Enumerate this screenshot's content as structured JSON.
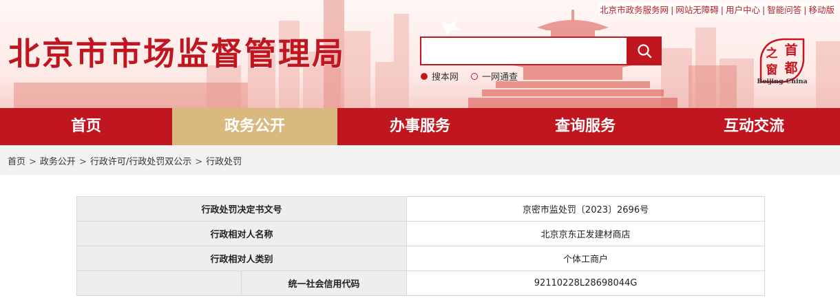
{
  "top_links": [
    "北京市政务服务网",
    "网站无障碍",
    "用户中心",
    "智能问答",
    "移动版"
  ],
  "site_title": "北京市市场监督管理局",
  "search": {
    "value": "",
    "placeholder": "",
    "scopes": [
      {
        "label": "搜本网",
        "selected": true
      },
      {
        "label": "一网通查",
        "selected": false
      }
    ]
  },
  "capital_logo": {
    "chars": [
      "首",
      "都",
      "之",
      "窗"
    ],
    "sub": "Beijing-China"
  },
  "nav": {
    "items": [
      "首页",
      "政务公开",
      "办事服务",
      "查询服务",
      "互动交流"
    ],
    "active_index": 1
  },
  "breadcrumb": [
    "首页",
    "政务公开",
    "行政许可/行政处罚双公示",
    "行政处罚"
  ],
  "breadcrumb_sep": ">",
  "detail_table": {
    "rows": [
      {
        "label": "行政处罚决定书文号",
        "value": "京密市监处罚〔2023〕2696号"
      },
      {
        "label": "行政相对人名称",
        "value": "北京京东正发建材商店"
      },
      {
        "label": "行政相对人类别",
        "value": "个体工商户"
      },
      {
        "label": "统一社会信用代码",
        "value": "92110228L28698044G"
      }
    ]
  },
  "colors": {
    "brand_red": "#c0161f",
    "nav_active": "#d9b97e",
    "label_bg": "#eeeeee",
    "crumb_bg": "#f2f2f2"
  }
}
